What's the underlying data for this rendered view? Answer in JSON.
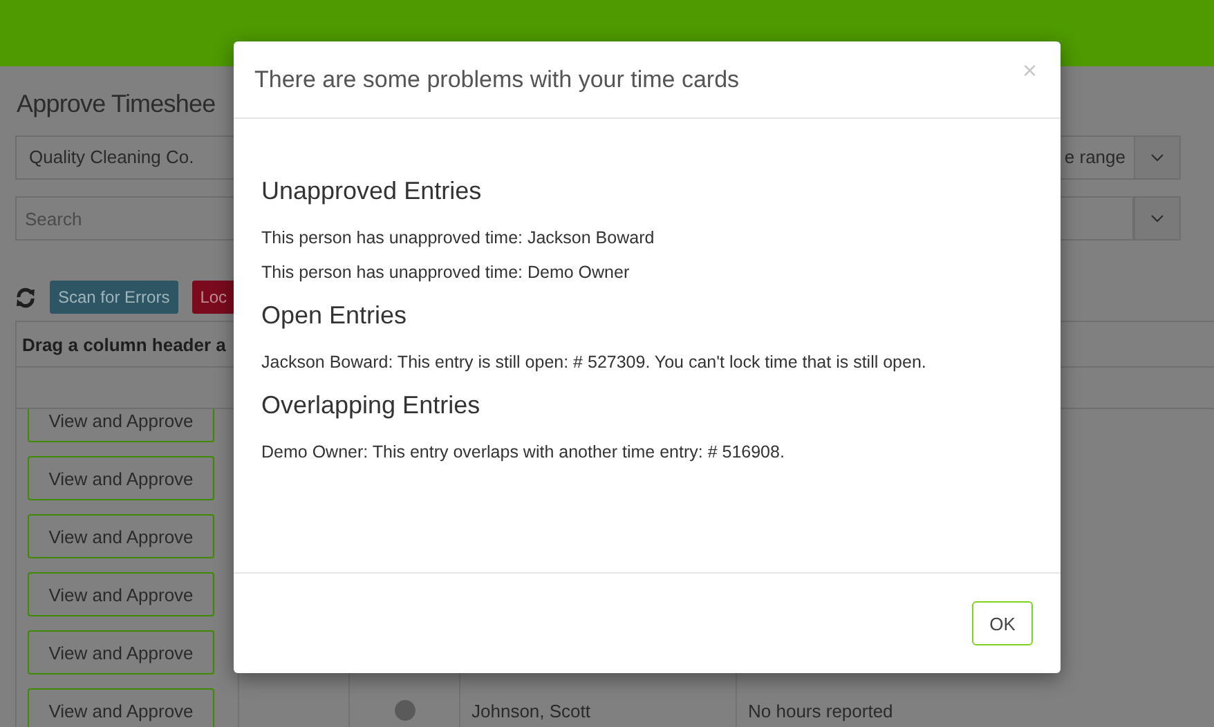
{
  "page": {
    "title": "Approve Timeshee",
    "company_select": {
      "value": "Quality Cleaning Co."
    },
    "range_select": {
      "value": "e range"
    },
    "search": {
      "placeholder": "Search"
    },
    "toolbar": [
      {
        "label": "Scan for Errors",
        "kind": "info"
      },
      {
        "label": "Loc",
        "kind": "danger"
      }
    ],
    "grid": {
      "group_panel": "Drag a column header a",
      "rows": [
        {
          "action": "View and Approve"
        },
        {
          "action": "View and Approve"
        },
        {
          "action": "View and Approve"
        },
        {
          "action": "View and Approve"
        },
        {
          "action": "View and Approve"
        },
        {
          "action": "View and Approve",
          "name": "Johnson, Scott",
          "hours": "No hours reported"
        }
      ]
    }
  },
  "dialog": {
    "title": "There are some problems with your time cards",
    "close": "×",
    "sections": [
      {
        "heading": "Unapproved Entries",
        "messages": [
          "This person has unapproved time: Jackson Boward",
          "This person has unapproved time: Demo Owner"
        ]
      },
      {
        "heading": "Open Entries",
        "messages": [
          "Jackson Boward: This entry is still open: # 527309. You can't lock time that is still open."
        ]
      },
      {
        "heading": "Overlapping Entries",
        "messages": [
          "Demo Owner: This entry overlaps with another time entry: # 516908."
        ]
      }
    ],
    "buttons": [
      "OK"
    ]
  }
}
